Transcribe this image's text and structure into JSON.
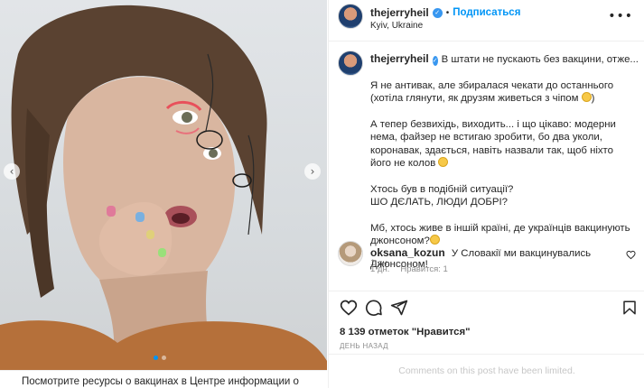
{
  "post": {
    "username": "thejerryheil",
    "follow_label": "Подписаться",
    "separator": "•",
    "location": "Kyiv, Ukraine",
    "more_icon": "more-horizontal-icon",
    "image_count": 2,
    "active_image": 1
  },
  "caption": {
    "first_line": "В штати не пускають без вакцини, отже...",
    "paragraphs": [
      "Я не антивак, але збиралася чекати до останнього (хотіла глянути, як друзям живеться з чіпом",
      "А тепер безвихідь, виходить... і що цікаво: модерни нема, файзер не встигаю зробити, бо два уколи, коронавак, здається, навіть назвали так, щоб ніхто його не колов",
      "Хтось був в подібній ситуації?\nШО ДЄЛАТЬ, ЛЮДИ ДОБРІ?",
      "Мб, хтось живе в іншій країні, де українців вакцинують джонсоном?"
    ],
    "p1_end": ")",
    "time": "1 дн."
  },
  "comment": {
    "username": "oksana_kozun",
    "text": "У Словакії ми вакцинувались Джонсоном!",
    "time": "1 дн.",
    "likes": "Нравится: 1"
  },
  "stats": {
    "likes_text": "8 139 отметок \"Нравится\"",
    "date": "ДЕНЬ НАЗАД"
  },
  "comments_limited": "Comments on this post have been limited.",
  "banner_text": "Посмотрите ресурсы о вакцинах в Центре информации о",
  "colors": {
    "accent": "#0095f6",
    "verified": "#3897f0",
    "muted": "#8e8e8e"
  }
}
